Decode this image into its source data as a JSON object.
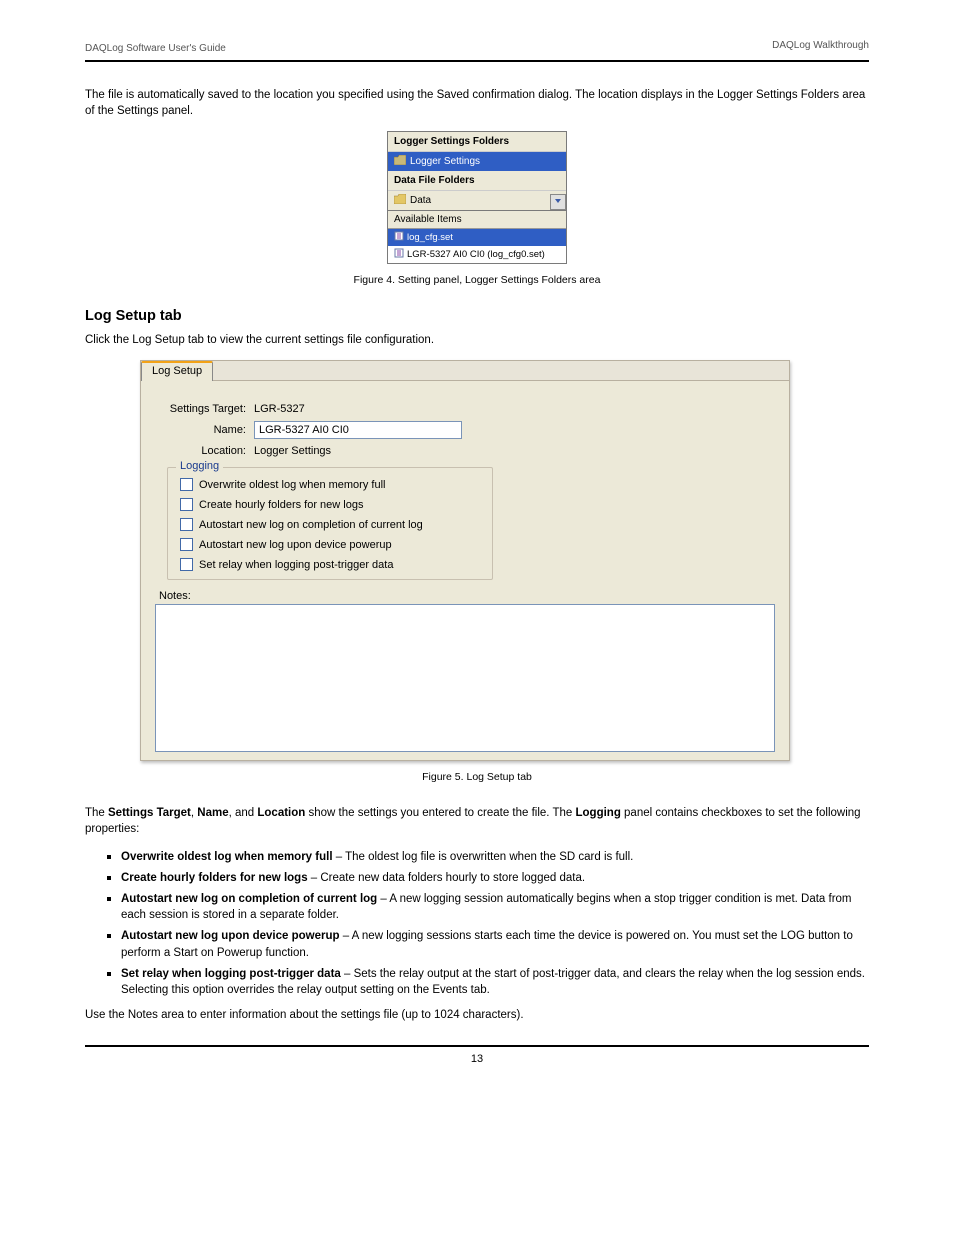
{
  "header": {
    "left": "DAQLog Software User's Guide",
    "right": "DAQLog Walkthrough"
  },
  "intro_text": "The file is automatically saved to the location you specified using the Saved confirmation dialog. The location displays in the Logger Settings Folders area of the Settings panel.",
  "small_panel": {
    "section1_title": "Logger Settings Folders",
    "item1": "Logger Settings",
    "section2_title": "Data File Folders",
    "item2": "Data",
    "available_title": "Available Items",
    "list_item1": "log_cfg.set",
    "list_item2": "LGR-5327 AI0 CI0 (log_cfg0.set)"
  },
  "figure_caption": "Figure 4. Setting panel, Logger Settings Folders area",
  "heading": "Log Setup tab",
  "heading_text": "Click the Log Setup tab to view the current settings file configuration.",
  "log_setup": {
    "tab_label": "Log Setup",
    "row1_label": "Settings Target:",
    "row1_value": "LGR-5327",
    "row2_label": "Name:",
    "row2_value": "LGR-5327 AI0 CI0",
    "row3_label": "Location:",
    "row3_value": "Logger Settings",
    "legend": "Logging",
    "cb1": "Overwrite oldest log when memory full",
    "cb2": "Create hourly folders for new logs",
    "cb3": "Autostart new log on completion of current log",
    "cb4": "Autostart new log upon device powerup",
    "cb5": "Set relay when logging post-trigger data",
    "notes_label": "Notes:"
  },
  "figure2_caption": "Figure 5. Log Setup tab",
  "post_text_a": "The ",
  "post_text_b": "Settings Target",
  "post_text_c": ", ",
  "post_text_d": "Name",
  "post_text_e": ", and ",
  "post_text_f": "Location",
  "post_text_g": " show the settings you entered to create the file. The ",
  "post_text_h": "Logging",
  "post_text_i": " panel contains checkboxes to set the following properties:",
  "bullets": {
    "b1_a": "Overwrite oldest log when memory full",
    "b1_b": " – The oldest log file is overwritten when the SD card is full.",
    "b2_a": "Create hourly folders for new logs",
    "b2_b": " – Create new data folders hourly to store logged data.",
    "b3_a": "Autostart new log on completion of current log",
    "b3_b": " – A new logging session automatically begins when a stop trigger condition is met. Data from each session is stored in a separate folder.",
    "b4_a": "Autostart new log upon device powerup",
    "b4_b": " – A new logging sessions starts each time the device is powered on. You must set the LOG button to perform a Start on Powerup function.",
    "b5_a": "Set relay when logging post-trigger data",
    "b5_b": " – Sets the relay output at the start of post-trigger data, and clears the relay when the log session ends.",
    "b5_note": "Selecting this option overrides the relay output setting on the Events tab."
  },
  "notes_hint": "Use the Notes area to enter information about the settings file (up to 1024 characters).",
  "page_number": "13"
}
